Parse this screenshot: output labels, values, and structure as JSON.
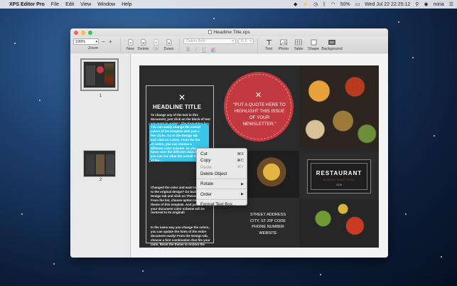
{
  "menubar": {
    "apple": "",
    "app_name": "XPS Editor Pro",
    "items": [
      "File",
      "Edit",
      "View",
      "Window",
      "Help"
    ],
    "battery": "50%",
    "clock": "Wed Jul 22  22:25:12",
    "user": "miria"
  },
  "window": {
    "title": "Headline Title.xps"
  },
  "toolbar": {
    "zoom_value": "100%",
    "zoom_label": "Zoom",
    "new_label": "New",
    "delete_label": "Delete",
    "up_label": "Up",
    "down_label": "Down",
    "font_name": "Gabon Bold",
    "font_size": "11.5",
    "bold": "B",
    "italic": "I",
    "underline": "U",
    "text_label": "Text",
    "photo_label": "Photo",
    "table_label": "Table",
    "shape_label": "Shape",
    "background_label": "Background"
  },
  "sidebar": {
    "pages": [
      {
        "number": "1",
        "selected": true
      },
      {
        "number": "2",
        "selected": false
      }
    ]
  },
  "document": {
    "headline": "HEADLINE TITLE",
    "para1": "To change any of the text in this document, just click on the block of text you want to update!  The formatting has already been programmed for ease of formatting.",
    "selected_para": "You can easily change the overall colors of the template with just a few clicks.  Go to the Design tab and click on Colors.  From the list of colors, you can choose a different color scheme.  As you hover over the different choices, you can see what the overall look of the...",
    "para3": "Changed the color and want to go back to the original design? Go back to the Design tab and click on Themes option. From the list, choose option to reset the theme of this template. And just like that, your document color scheme will be restored to its original!",
    "para4": "In the same way you change the colors, you can update the fonts of the entire document easily! From the Design tab, choose a font combination that fits your taste.  Reset the theme to restore the template to its original state!",
    "quote": "\"PUT A QUOTE HERE TO HIGHLIGHT THIS ISSUE OF YOUR NEWSLETTER.\"",
    "address_lines": [
      "STREET ADDRESS",
      "CITY, ST ZIP CODE",
      "PHONE NUMBER",
      "WEBSITE"
    ],
    "restaurant_title": "RESTAURANT",
    "restaurant_sub": "SLOGAN GOES HERE",
    "restaurant_est": "2018"
  },
  "context_menu": {
    "items": [
      {
        "label": "Cut",
        "shortcut": "⌘X",
        "enabled": true
      },
      {
        "label": "Copy",
        "shortcut": "⌘C",
        "enabled": true
      },
      {
        "label": "Paste",
        "shortcut": "⌘V",
        "enabled": false
      },
      {
        "label": "Delete Object",
        "shortcut": "",
        "enabled": true
      },
      {
        "label": "Rotate",
        "submenu": true,
        "enabled": true
      },
      {
        "label": "Order",
        "submenu": true,
        "enabled": true
      },
      {
        "label": "Format Text Box...",
        "shortcut": "",
        "enabled": true
      }
    ]
  },
  "colors": {
    "accent_red": "#c2393f",
    "selection_cyan": "#39c6e8",
    "page_dark": "#2b2b2b"
  }
}
